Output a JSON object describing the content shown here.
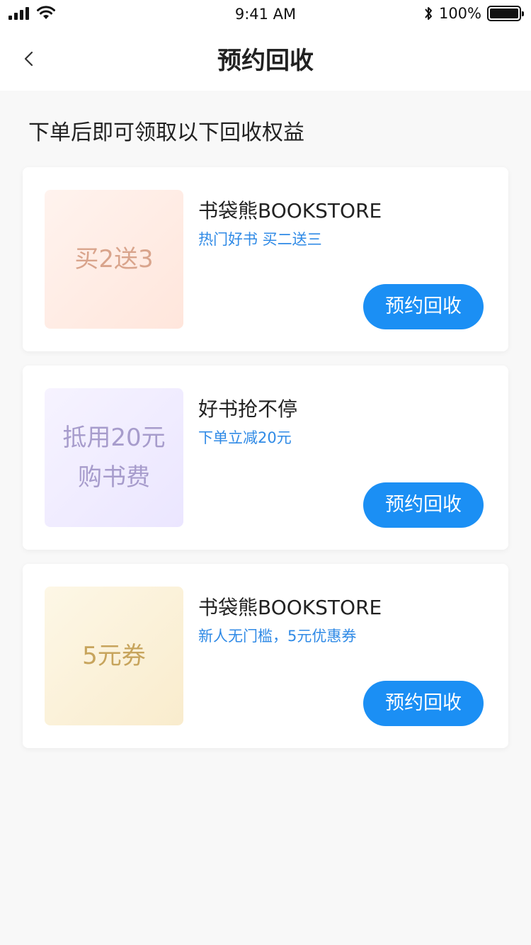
{
  "status_bar": {
    "time": "9:41 AM",
    "battery": "100%"
  },
  "nav": {
    "title": "预约回收",
    "back_icon": "chevron-left-icon"
  },
  "section_title": "下单后即可领取以下回收权益",
  "cards": [
    {
      "thumb_lines": [
        "买2送3"
      ],
      "title": "书袋熊BOOKSTORE",
      "subtitle": "热门好书 买二送三",
      "button": "预约回收"
    },
    {
      "thumb_lines": [
        "抵用20元",
        "购书费"
      ],
      "title": "好书抢不停",
      "subtitle": "下单立减20元",
      "button": "预约回收"
    },
    {
      "thumb_lines": [
        "5元券"
      ],
      "title": "书袋熊BOOKSTORE",
      "subtitle": "新人无门槛，5元优惠券",
      "button": "预约回收"
    }
  ],
  "colors": {
    "accent": "#1b8ff4",
    "subtitle": "#2f8ae6",
    "background": "#f8f8f8"
  }
}
